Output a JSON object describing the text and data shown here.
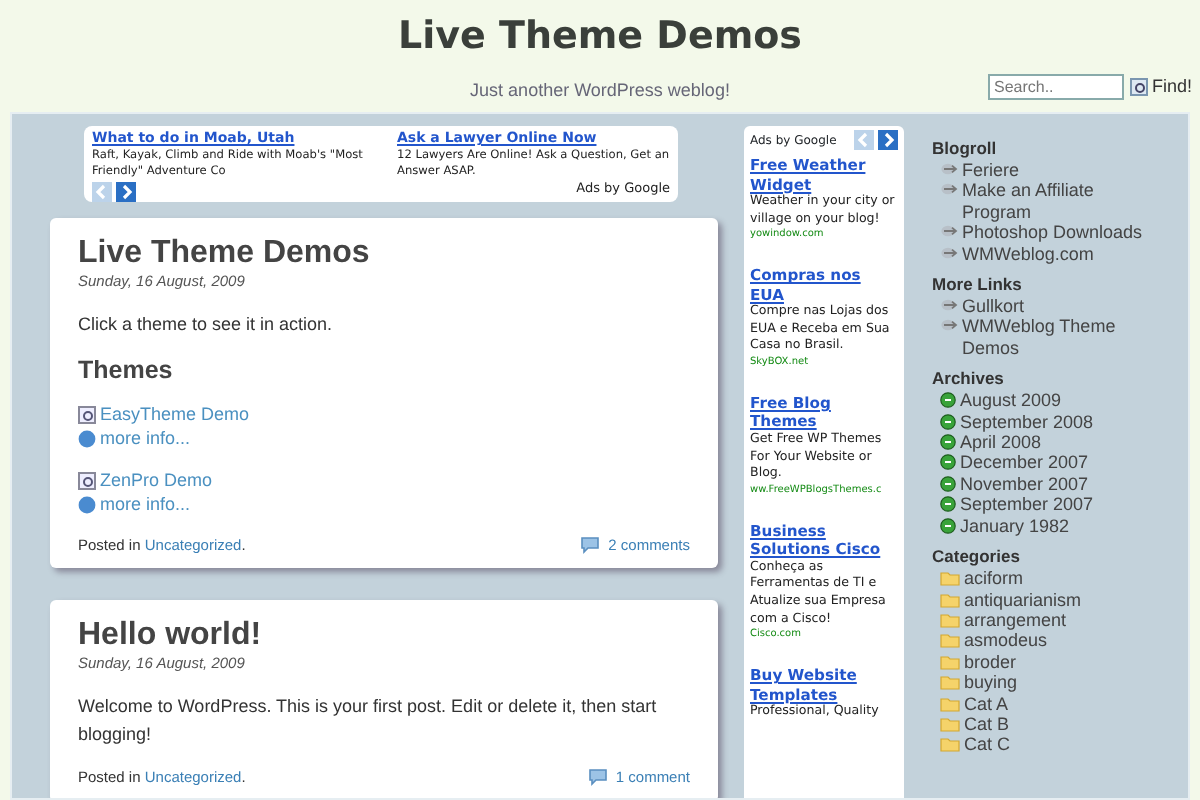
{
  "site": {
    "title": "Live Theme Demos",
    "tagline": "Just another WordPress weblog!"
  },
  "search": {
    "placeholder": "Search..",
    "button": "Find!"
  },
  "top_ad": {
    "ads": [
      {
        "title": "What to do in Moab, Utah",
        "text": "Raft, Kayak, Climb and Ride with Moab's \"Most Friendly\" Adventure Co"
      },
      {
        "title": "Ask a Lawyer Online Now",
        "text": "12 Lawyers Are Online! Ask a Question, Get an Answer ASAP."
      }
    ],
    "footer": "Ads by Google"
  },
  "posts": [
    {
      "title": "Live Theme Demos",
      "date": "Sunday, 16 August, 2009",
      "body": "Click a theme to see it in action.",
      "heading": "Themes",
      "links": [
        {
          "label": "EasyTheme Demo",
          "info": "more info..."
        },
        {
          "label": "ZenPro Demo",
          "info": "more info..."
        }
      ],
      "posted_in": "Posted in",
      "category": "Uncategorized",
      "suffix": ".",
      "comments": "2 comments"
    },
    {
      "title": "Hello world!",
      "date": "Sunday, 16 August, 2009",
      "body": "Welcome to WordPress. This is your first post. Edit or delete it, then start blogging!",
      "posted_in": "Posted in",
      "category": "Uncategorized",
      "suffix": ".",
      "comments": "1 comment"
    }
  ],
  "side_ad": {
    "header": "Ads by Google",
    "ads": [
      {
        "title": "Free Weather Widget",
        "text": "Weather in your city or village on your blog!",
        "url": "yowindow.com"
      },
      {
        "title": "Compras nos EUA",
        "text": "Compre nas Lojas dos EUA e Receba em Sua Casa no Brasil.",
        "url": "SkyBOX.net"
      },
      {
        "title": "Free Blog Themes",
        "text": "Get Free WP Themes For Your Website or Blog.",
        "url": "ww.FreeWPBlogsThemes.c"
      },
      {
        "title": "Business Solutions Cisco",
        "text": "Conheça as Ferramentas de TI e Atualize sua Empresa com a Cisco!",
        "url": "Cisco.com"
      },
      {
        "title": "Buy Website Templates",
        "text": "Professional, Quality"
      }
    ]
  },
  "sidebar": [
    {
      "title": "Blogroll",
      "kind": "link",
      "items": [
        "Feriere",
        "Make an Affiliate Program",
        "Photoshop Downloads",
        "WMWeblog.com"
      ]
    },
    {
      "title": "More Links",
      "kind": "link",
      "items": [
        "Gullkort",
        "WMWeblog Theme Demos"
      ]
    },
    {
      "title": "Archives",
      "kind": "archive",
      "items": [
        "August 2009",
        "September 2008",
        "April 2008",
        "December 2007",
        "November 2007",
        "September 2007",
        "January 1982"
      ]
    },
    {
      "title": "Categories",
      "kind": "category",
      "items": [
        "aciform",
        "antiquarianism",
        "arrangement",
        "asmodeus",
        "broder",
        "buying",
        "Cat A",
        "Cat B",
        "Cat C"
      ]
    }
  ]
}
